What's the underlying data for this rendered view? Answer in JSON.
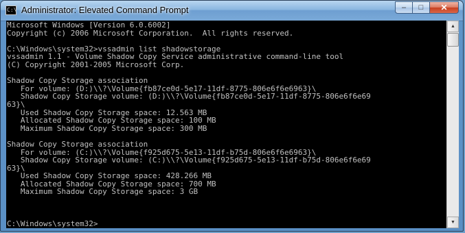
{
  "window": {
    "title": "Administrator: Elevated Command Prompt",
    "icon": "cmd-icon",
    "icon_glyph": "C:\\",
    "buttons": {
      "minimize": "–",
      "maximize": "□",
      "close": "✕"
    }
  },
  "console": {
    "lines": [
      "Microsoft Windows [Version 6.0.6002]",
      "Copyright (c) 2006 Microsoft Corporation.  All rights reserved.",
      "",
      "C:\\Windows\\system32>vssadmin list shadowstorage",
      "vssadmin 1.1 - Volume Shadow Copy Service administrative command-line tool",
      "(C) Copyright 2001-2005 Microsoft Corp.",
      "",
      "Shadow Copy Storage association",
      "   For volume: (D:)\\\\?\\Volume{fb87ce0d-5e17-11df-8775-806e6f6e6963}\\",
      "   Shadow Copy Storage volume: (D:)\\\\?\\Volume{fb87ce0d-5e17-11df-8775-806e6f6e69",
      "63}\\",
      "   Used Shadow Copy Storage space: 12.563 MB",
      "   Allocated Shadow Copy Storage space: 100 MB",
      "   Maximum Shadow Copy Storage space: 300 MB",
      "",
      "Shadow Copy Storage association",
      "   For volume: (C:)\\\\?\\Volume{f925d675-5e13-11df-b75d-806e6f6e6963}\\",
      "   Shadow Copy Storage volume: (C:)\\\\?\\Volume{f925d675-5e13-11df-b75d-806e6f6e69",
      "63}\\",
      "   Used Shadow Copy Storage space: 428.266 MB",
      "   Allocated Shadow Copy Storage space: 700 MB",
      "   Maximum Shadow Copy Storage space: 3 GB",
      "",
      "",
      "",
      "C:\\Windows\\system32>"
    ]
  },
  "scrollbar": {
    "up_glyph": "▲",
    "down_glyph": "▼"
  }
}
